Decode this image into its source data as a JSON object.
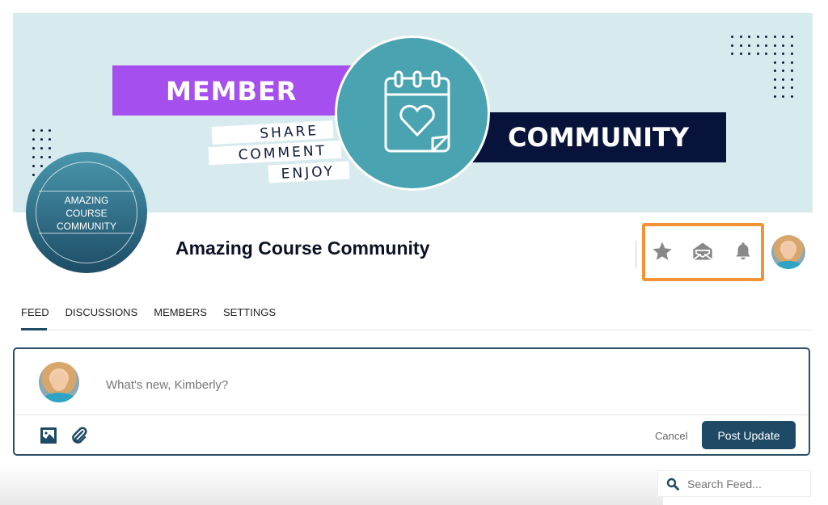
{
  "banner": {
    "member_label": "MEMBER",
    "strips": [
      "SHARE",
      "COMMENT",
      "ENJOY"
    ],
    "community_label": "COMMUNITY",
    "colors": {
      "background": "#d7eaee",
      "purple": "#a550ee",
      "navy": "#07133a",
      "teal": "#4aa3b0"
    }
  },
  "group": {
    "logo_lines": [
      "AMAZING",
      "COURSE",
      "COMMUNITY"
    ],
    "title": "Amazing Course Community"
  },
  "header_actions": {
    "icons": [
      "star-icon",
      "envelope-open-icon",
      "bell-icon"
    ],
    "highlight_color": "#f39237"
  },
  "tabs": [
    {
      "label": "FEED",
      "active": true
    },
    {
      "label": "DISCUSSIONS",
      "active": false
    },
    {
      "label": "MEMBERS",
      "active": false
    },
    {
      "label": "SETTINGS",
      "active": false
    }
  ],
  "composer": {
    "placeholder": "What's new, Kimberly?",
    "cancel_label": "Cancel",
    "post_label": "Post Update",
    "accent": "#1e4a66"
  },
  "search": {
    "placeholder": "Search Feed..."
  }
}
